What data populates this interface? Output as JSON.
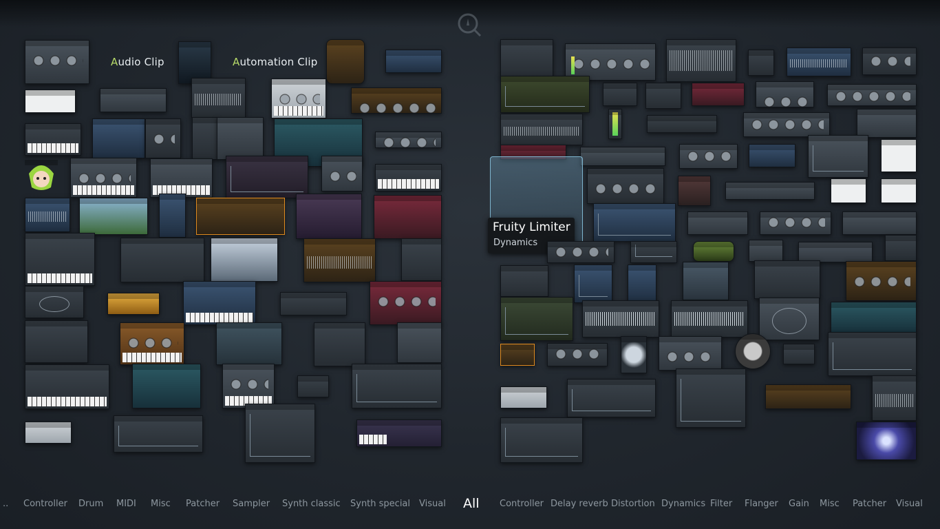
{
  "clip_labels": {
    "audio_clip": {
      "first": "A",
      "rest": "udio Clip"
    },
    "automation_clip": {
      "first": "A",
      "rest": "utomation Clip"
    }
  },
  "tooltip": {
    "title": "Fruity Limiter",
    "category": "Dynamics"
  },
  "categories": {
    "dots": "..",
    "generators": [
      "Controller",
      "Drum",
      "MIDI",
      "Misc",
      "Patcher",
      "Sampler",
      "Synth classic",
      "Synth special",
      "Visual"
    ],
    "all": "All",
    "effects": [
      "Controller",
      "Delay reverb",
      "Distortion",
      "Dynamics",
      "Filter",
      "Flanger",
      "Gain",
      "Misc",
      "Patcher",
      "Visual"
    ]
  },
  "icons": {
    "search": "search-icon",
    "avatar": "mascot-icon"
  },
  "colors": {
    "background": "#20262d",
    "clip_accent": "#b8dc6a",
    "active_category": "#ffffff",
    "inactive_category": "#8d979f"
  }
}
